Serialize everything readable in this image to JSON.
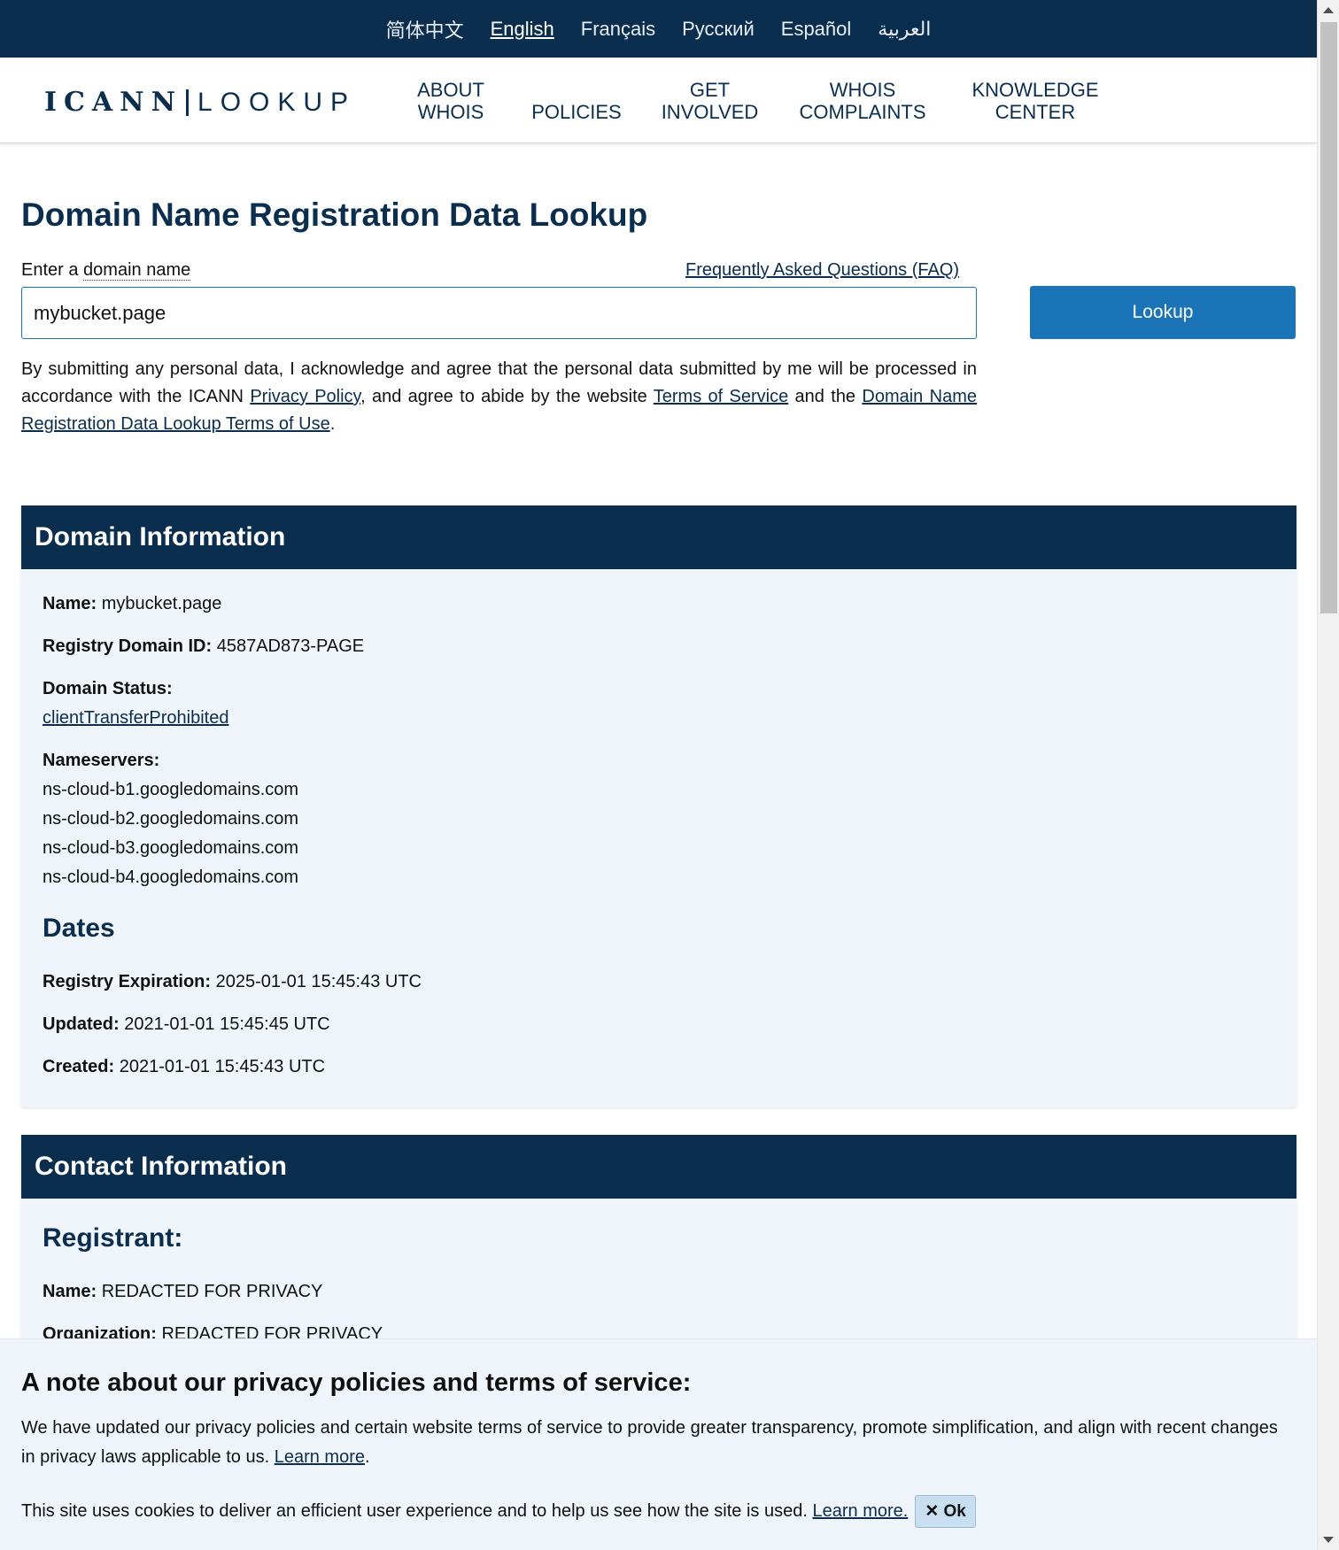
{
  "languages": [
    "简体中文",
    "English",
    "Français",
    "Русский",
    "Español",
    "العربية"
  ],
  "active_language": "English",
  "logo": {
    "left": "ICANN",
    "right": "LOOKUP"
  },
  "nav": [
    {
      "line1": "ABOUT",
      "line2": "WHOIS"
    },
    {
      "line1": "",
      "line2": "POLICIES"
    },
    {
      "line1": "GET",
      "line2": "INVOLVED"
    },
    {
      "line1": "WHOIS",
      "line2": "COMPLAINTS"
    },
    {
      "line1": "KNOWLEDGE",
      "line2": "CENTER"
    }
  ],
  "page_title": "Domain Name Registration Data Lookup",
  "form": {
    "label_prefix": "Enter a ",
    "label_link": "domain name",
    "faq": "Frequently Asked Questions (FAQ)",
    "input_value": "mybucket.page",
    "button": "Lookup",
    "consent_1": "By submitting any personal data, I acknowledge and agree that the personal data submitted by me will be processed in accordance with the ICANN ",
    "privacy_link": "Privacy Policy",
    "consent_2": ", and agree to abide by the website ",
    "tos_link": "Terms of Service",
    "consent_3": " and the ",
    "tou_link": "Domain Name Registration Data Lookup Terms of Use",
    "consent_4": "."
  },
  "domain_info": {
    "heading": "Domain Information",
    "name_label": "Name:",
    "name_value": "mybucket.page",
    "id_label": "Registry Domain ID:",
    "id_value": "4587AD873-PAGE",
    "status_label": "Domain Status:",
    "status_value": "clientTransferProhibited",
    "ns_label": "Nameservers:",
    "nameservers": [
      "ns-cloud-b1.googledomains.com",
      "ns-cloud-b2.googledomains.com",
      "ns-cloud-b3.googledomains.com",
      "ns-cloud-b4.googledomains.com"
    ],
    "dates_heading": "Dates",
    "expiration_label": "Registry Expiration:",
    "expiration_value": "2025-01-01 15:45:43 UTC",
    "updated_label": "Updated:",
    "updated_value": "2021-01-01 15:45:45 UTC",
    "created_label": "Created:",
    "created_value": "2021-01-01 15:45:43 UTC"
  },
  "contact_info": {
    "heading": "Contact Information",
    "registrant_heading": "Registrant:",
    "name_label": "Name:",
    "name_value": "REDACTED FOR PRIVACY",
    "org_label": "Organization:",
    "org_value": "REDACTED FOR PRIVACY"
  },
  "banner": {
    "heading": "A note about our privacy policies and terms of service:",
    "text1": "We have updated our privacy policies and certain website terms of service to provide greater transparency, promote simplification, and align with recent changes in privacy laws applicable to us. ",
    "learn_more_1": "Learn more",
    "text1_end": ".",
    "text2": "This site uses cookies to deliver an efficient user experience and to help us see how the site is used. ",
    "learn_more_2": "Learn more.",
    "ok_icon": "close-icon",
    "ok_label": "Ok"
  }
}
